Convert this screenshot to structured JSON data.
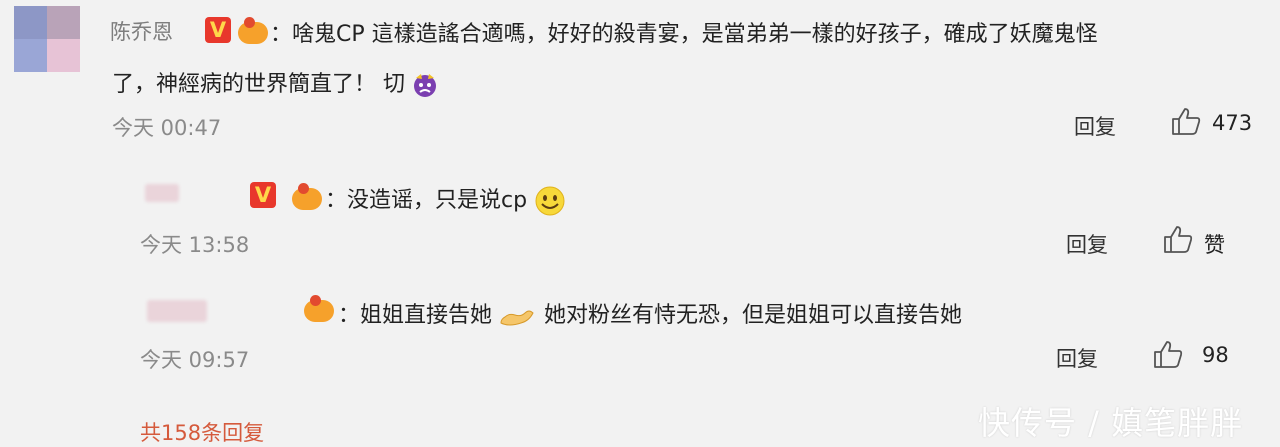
{
  "comment": {
    "username": "陈乔恩",
    "badge": "V",
    "text_line1": "：啥鬼CP 這樣造謠合適嗎，好好的殺青宴，是當弟弟一樣的好孩子，確成了妖魔鬼怪",
    "text_line2": "了，神經病的世界簡直了！ 切",
    "time": "今天 00:47",
    "reply_label": "回复",
    "like_count": "473",
    "emoji_icon": "angry-face-icon"
  },
  "replies": [
    {
      "badge": "V",
      "text": "：没造谣，只是说cp",
      "time": "今天 13:58",
      "reply_label": "回复",
      "like_label": "赞",
      "emoji_icon": "smiley-icon"
    },
    {
      "text_before": "：姐姐直接告她",
      "text_after": "她对粉丝有恃无恐，但是姐姐可以直接告她",
      "time": "今天 09:57",
      "reply_label": "回复",
      "like_count": "98",
      "emoji_icon": "flexed-arm-icon"
    }
  ],
  "total_replies": "共158条回复",
  "watermark": "快传号 / 嫃笔胖胖",
  "colors": {
    "badge_red": "#e8382c",
    "badge_yellow": "#ffd84a",
    "link_orange": "#d55a3c"
  }
}
